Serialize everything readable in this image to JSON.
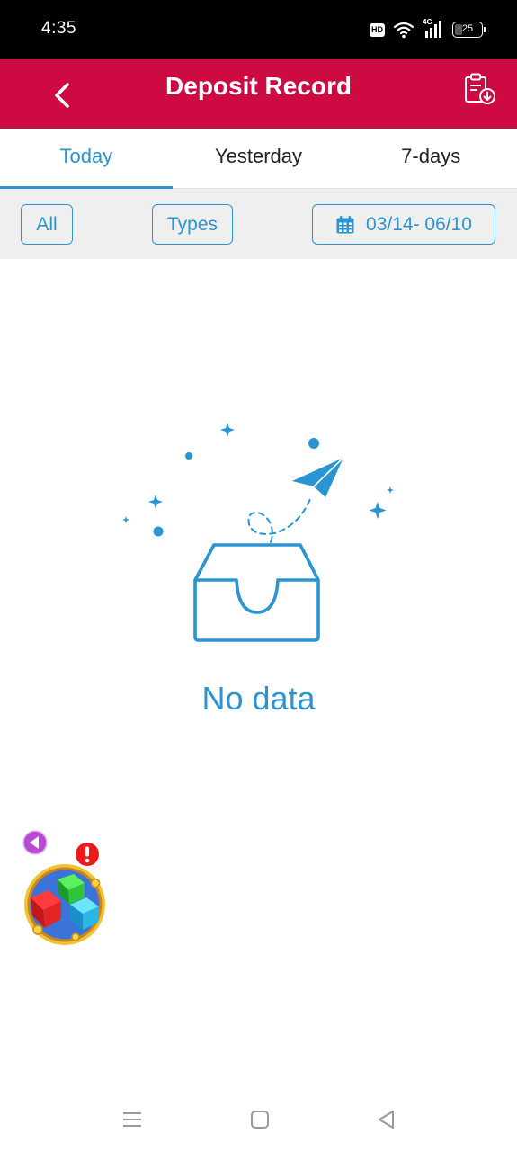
{
  "status_bar": {
    "time": "4:35",
    "hd_label": "HD",
    "network_label": "4G",
    "battery_level": "25"
  },
  "header": {
    "title": "Deposit Record",
    "back_icon": "chevron-left-icon",
    "export_icon": "clipboard-download-icon"
  },
  "tabs": [
    {
      "label": "Today",
      "active": true
    },
    {
      "label": "Yesterday",
      "active": false
    },
    {
      "label": "7-days",
      "active": false
    }
  ],
  "filters": {
    "all_label": "All",
    "types_label": "Types",
    "date_range": "03/14- 06/10",
    "date_icon": "calendar-icon"
  },
  "empty_state": {
    "message": "No data",
    "icon": "empty-tray-paper-plane-icon"
  },
  "floating_widget": {
    "icon": "game-cubes-icon",
    "alert_icon": "exclamation-icon",
    "collapse_icon": "triangle-left-icon"
  },
  "colors": {
    "brand": "#cd0b42",
    "accent": "#2a95d2",
    "filter_bg": "#efefef"
  }
}
